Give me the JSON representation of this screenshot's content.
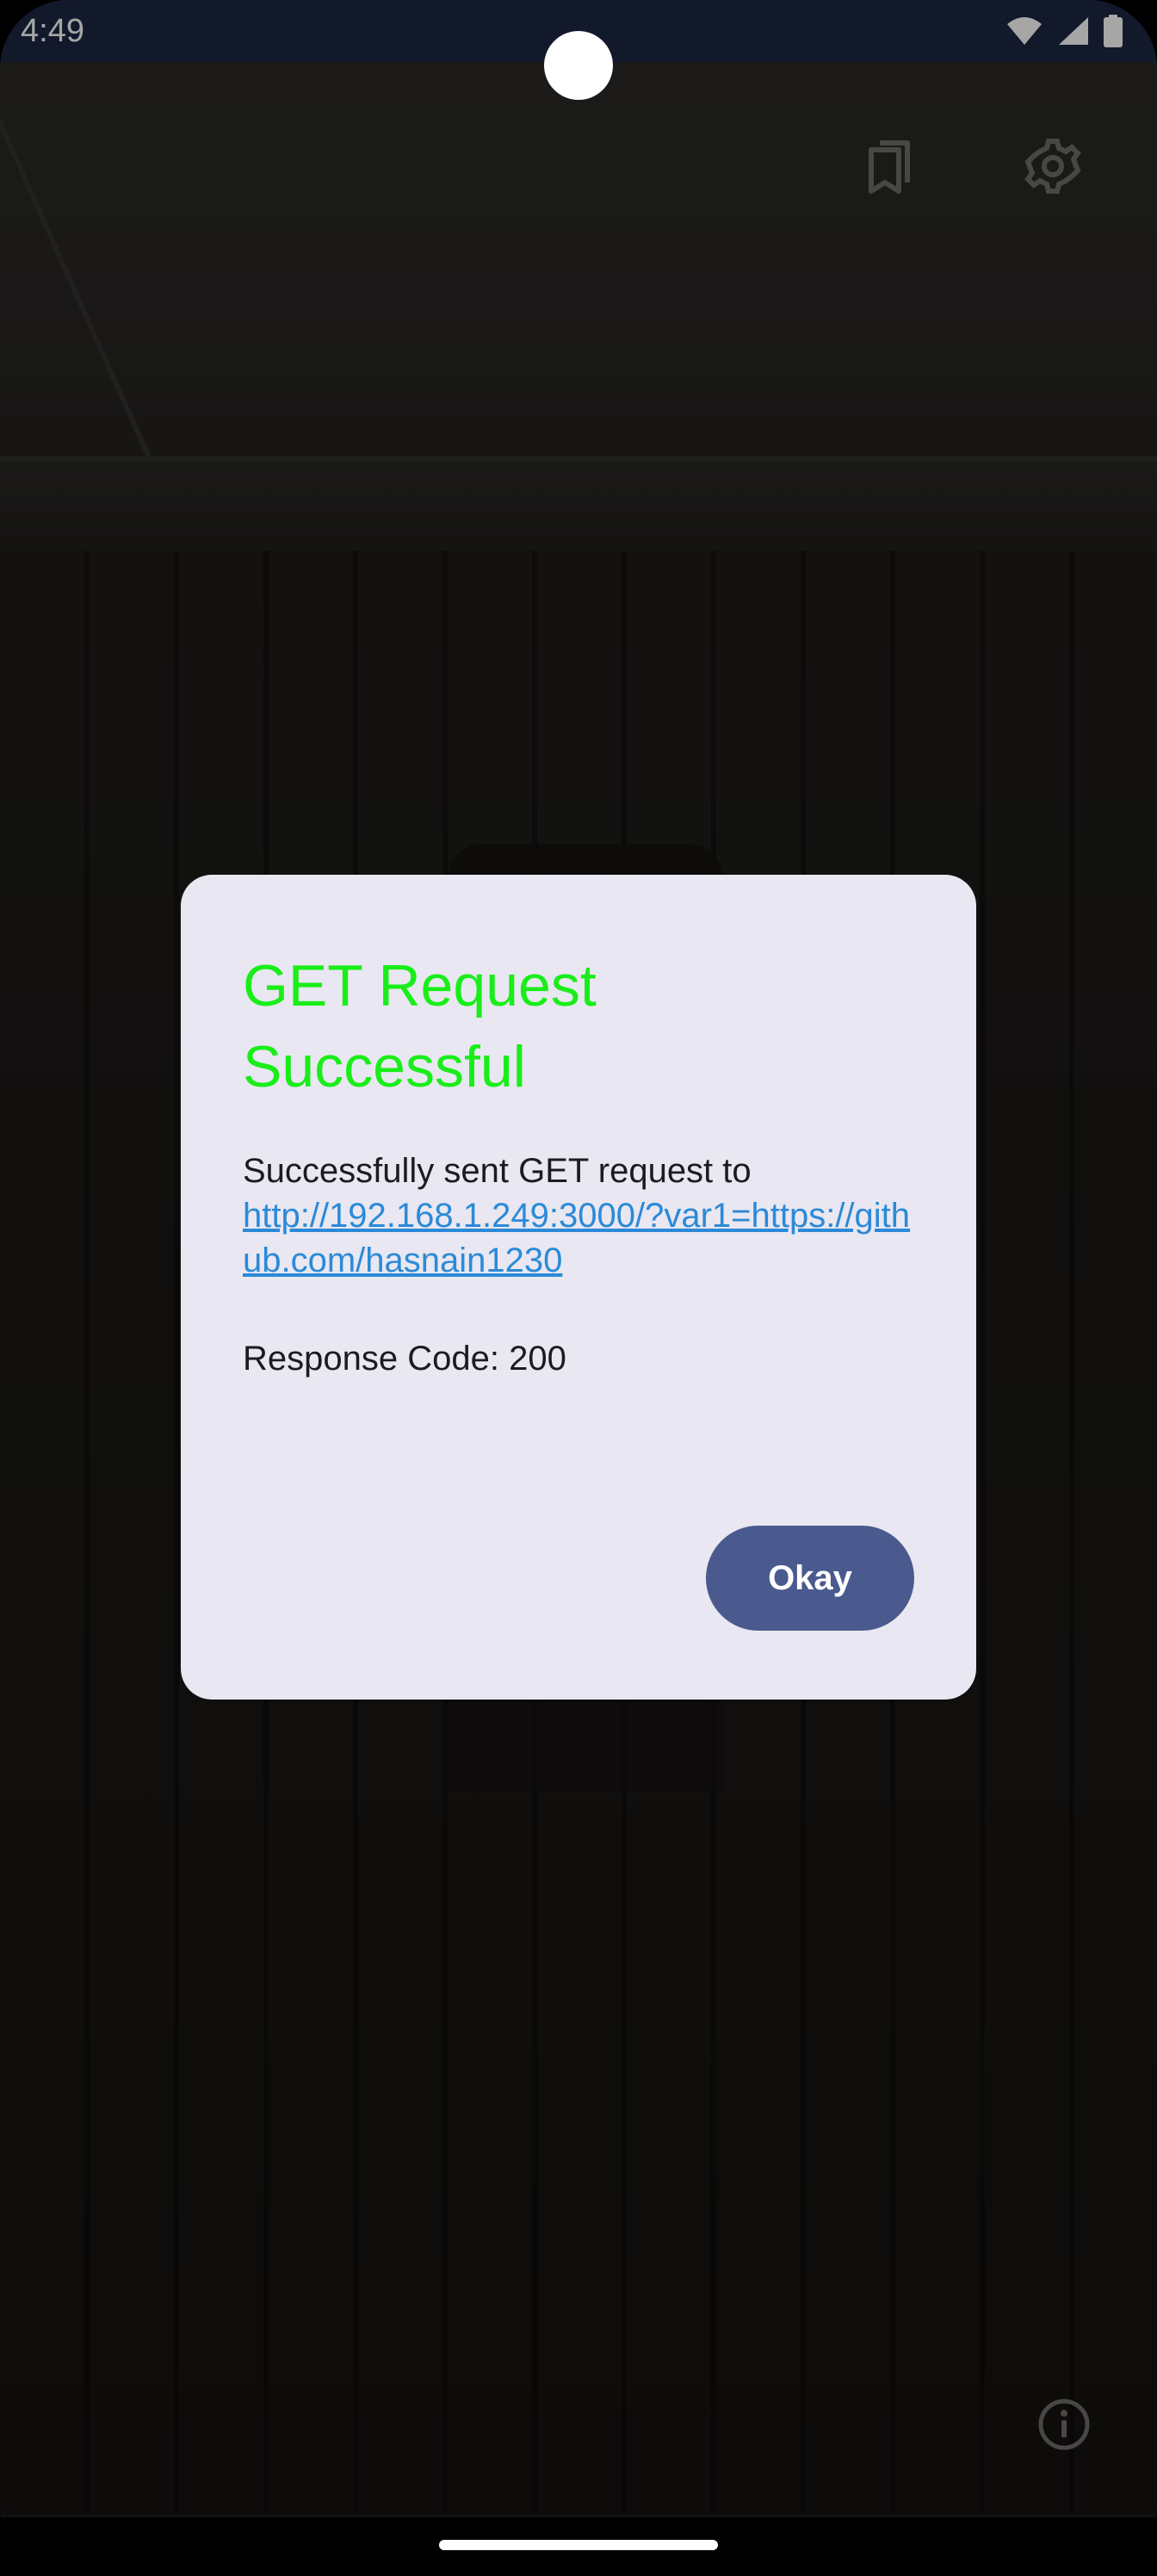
{
  "status_bar": {
    "time": "4:49",
    "icons": [
      "wifi-icon",
      "cellular-signal-icon",
      "battery-icon"
    ]
  },
  "toolbar": {
    "icons": [
      "bookmarks-icon",
      "settings-gear-icon"
    ]
  },
  "dialog": {
    "title": "GET Request Successful",
    "message": "Successfully sent GET request to",
    "link": "http://192.168.1.249:3000/?var1=https://github.com/hasnain1230",
    "response_code": "Response Code: 200",
    "ok_label": "Okay"
  },
  "bottom": {
    "icons": [
      "info-icon"
    ]
  },
  "colors": {
    "title": "#19ee19",
    "link": "#2b8ad8",
    "button": "#4a5a8e",
    "dialog_bg": "#e9e7f1",
    "status_bar": "#1d2743"
  }
}
